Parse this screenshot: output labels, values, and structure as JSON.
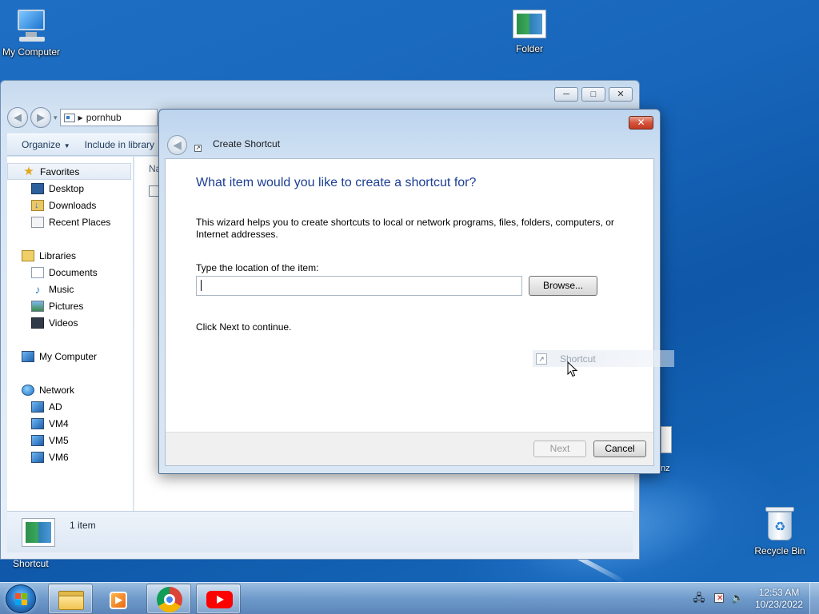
{
  "desktop": {
    "icons": [
      {
        "label": "My Computer",
        "icon": "computer-icon"
      },
      {
        "label": "Folder",
        "icon": "folder-thumbnail-icon"
      },
      {
        "label": "Recycle Bin",
        "icon": "recycle-bin-icon"
      }
    ],
    "shortcut_label": "Shortcut",
    "partial_label": "nz"
  },
  "explorer": {
    "address": "pornhub",
    "toolbar": {
      "organize": "Organize",
      "include_in_library": "Include in library"
    },
    "window_controls": {
      "minimize": "─",
      "maximize": "□",
      "close": "✕"
    },
    "nav": {
      "favorites": "Favorites",
      "favorites_items": [
        "Desktop",
        "Downloads",
        "Recent Places"
      ],
      "libraries": "Libraries",
      "libraries_items": [
        "Documents",
        "Music",
        "Pictures",
        "Videos"
      ],
      "my_computer": "My Computer",
      "network": "Network",
      "network_items": [
        "AD",
        "VM4",
        "VM5",
        "VM6"
      ]
    },
    "column_header": "Na",
    "details": {
      "count": "1 item"
    }
  },
  "dialog": {
    "close": "✕",
    "title": "Create Shortcut",
    "heading": "What item would you like to create a shortcut for?",
    "description": "This wizard helps you to create shortcuts to local or network programs, files, folders, computers, or Internet addresses.",
    "location_label": "Type the location of the item:",
    "location_value": "",
    "browse": "Browse...",
    "continue_text": "Click Next to continue.",
    "next": "Next",
    "cancel": "Cancel"
  },
  "drag_ghost": {
    "label": "Shortcut"
  },
  "taskbar": {
    "apps": [
      "windows-explorer",
      "media-player",
      "google-chrome",
      "youtube"
    ],
    "clock": {
      "time": "12:53 AM",
      "date": "10/23/2022"
    }
  },
  "colors": {
    "desktop_blue": "#1766bb",
    "heading_blue": "#1c3f94",
    "close_red": "#c23a22"
  }
}
